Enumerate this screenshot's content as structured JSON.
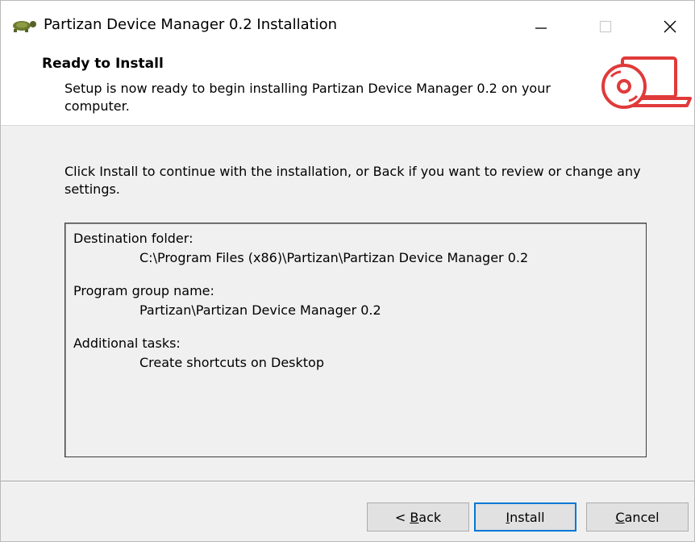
{
  "window": {
    "title": "Partizan Device Manager 0.2 Installation",
    "controls": {
      "minimize": "minimize",
      "maximize": "maximize",
      "close": "close"
    }
  },
  "header": {
    "title": "Ready to Install",
    "subtitle": "Setup is now ready to begin installing Partizan Device Manager 0.2 on your computer.",
    "graphic": "laptop-with-disc-icon"
  },
  "body": {
    "instruction": "Click Install to continue with the installation, or Back if you want to review or change any settings.",
    "memo": [
      {
        "label": "Destination folder:",
        "value": "C:\\Program Files (x86)\\Partizan\\Partizan Device Manager 0.2"
      },
      {
        "label": "Program group name:",
        "value": "Partizan\\Partizan Device Manager 0.2"
      },
      {
        "label": "Additional tasks:",
        "value": "Create shortcuts on Desktop"
      }
    ]
  },
  "buttons": {
    "back": {
      "prefix": "< ",
      "mnemonic": "B",
      "rest": "ack"
    },
    "install": {
      "mnemonic": "I",
      "rest": "nstall"
    },
    "cancel": {
      "mnemonic": "C",
      "rest": "ancel"
    }
  },
  "colors": {
    "accent": "#0078d7",
    "graphic_red": "#e03a3a",
    "app_icon": "#6b7a2e"
  }
}
